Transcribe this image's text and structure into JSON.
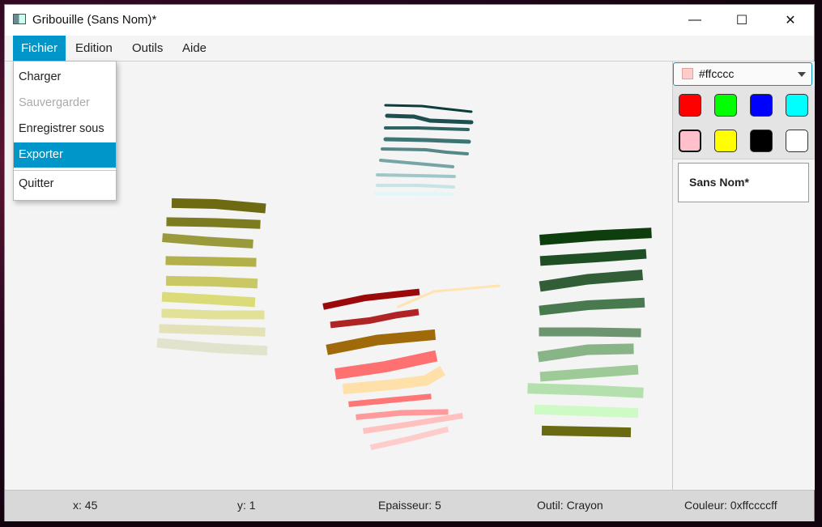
{
  "window": {
    "title": "Gribouille (Sans Nom)*",
    "controls": {
      "minimize": "—",
      "maximize": "☐",
      "close": "✕"
    }
  },
  "menubar": {
    "items": [
      {
        "label": "Fichier"
      },
      {
        "label": "Edition"
      },
      {
        "label": "Outils"
      },
      {
        "label": "Aide"
      }
    ]
  },
  "file_menu": {
    "items": [
      {
        "label": "Charger",
        "state": "normal"
      },
      {
        "label": "Sauvergarder",
        "state": "disabled"
      },
      {
        "label": "Enregistrer sous",
        "state": "normal"
      },
      {
        "label": "Exporter",
        "state": "highlighted"
      },
      {
        "label": "Quitter",
        "state": "normal"
      }
    ]
  },
  "side_panel": {
    "color_picker": {
      "value": "#ffcccc",
      "swatch_color": "#ffcccc"
    },
    "palette": [
      {
        "name": "red",
        "color": "#ff0000"
      },
      {
        "name": "green",
        "color": "#00ff00"
      },
      {
        "name": "blue",
        "color": "#0000ff"
      },
      {
        "name": "cyan",
        "color": "#00ffff"
      },
      {
        "name": "pink",
        "color": "#ffc0cb",
        "selected": true
      },
      {
        "name": "yellow",
        "color": "#ffff00"
      },
      {
        "name": "black",
        "color": "#000000"
      },
      {
        "name": "white",
        "color": "#ffffff"
      }
    ],
    "document_name": "Sans Nom*"
  },
  "statusbar": {
    "x": "x: 45",
    "y": "y: 1",
    "thickness": "Epaisseur: 5",
    "tool": "Outil: Crayon",
    "color": "Couleur: 0xffccccff"
  }
}
